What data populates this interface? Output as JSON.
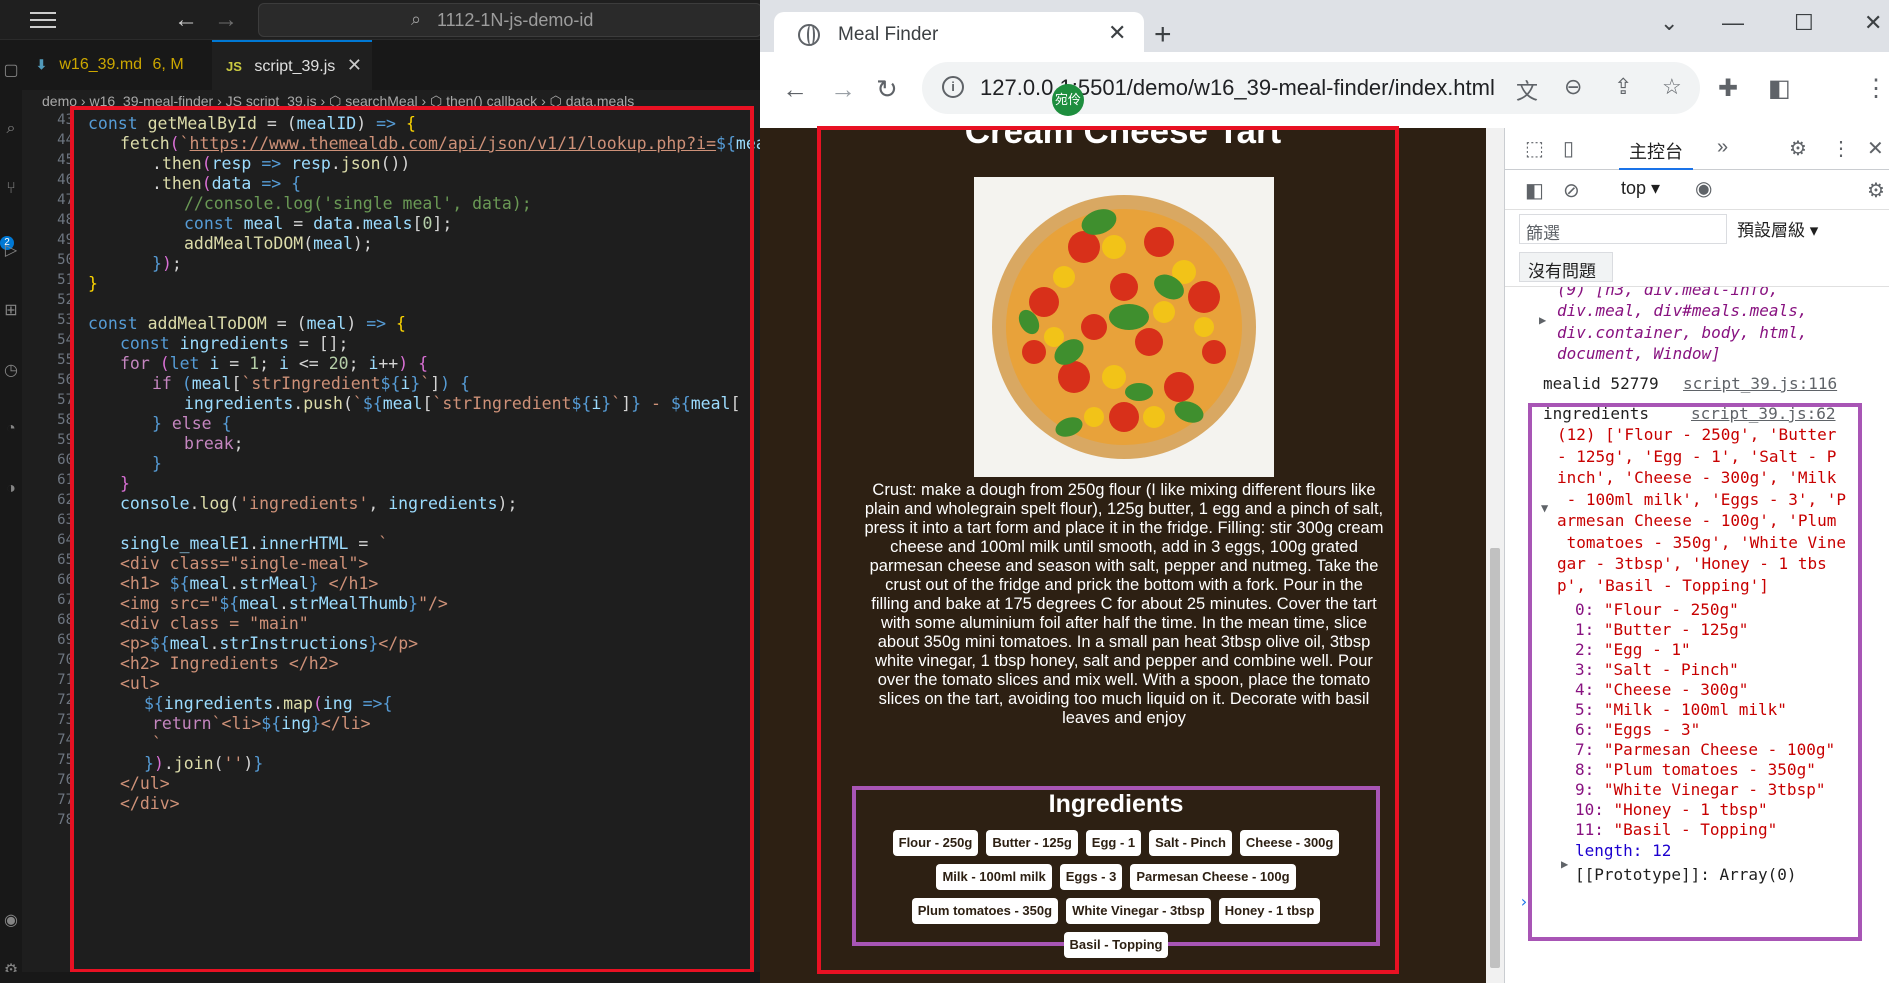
{
  "vscode": {
    "search_text": "1112-1N-js-demo-id",
    "tabs": [
      {
        "label": "w16_39.md",
        "status": "6, M",
        "icon": "md-icon"
      },
      {
        "label": "script_39.js",
        "icon": "js-icon"
      }
    ],
    "js_icon_text": "JS",
    "md_icon_text": "⬇",
    "breadcrumb": "demo › w16_39-meal-finder › JS script_39.js › ⬡ searchMeal › ⬡ then() callback › ⬡ data.meals",
    "line_numbers": [
      "43",
      "44",
      "45",
      "46",
      "47",
      "48",
      "49",
      "50",
      "51",
      "52",
      "53",
      "54",
      "55",
      "56",
      "57",
      "58",
      "59",
      "60",
      "61",
      "62",
      "63",
      "64",
      "65",
      "66",
      "67",
      "68",
      "69",
      "70",
      "71",
      "72",
      "73",
      "74",
      "75",
      "76",
      "77",
      "78"
    ],
    "activity_badge": "2"
  },
  "chrome": {
    "tab_title": "Meal Finder",
    "url": "127.0.0.1:5501/demo/w16_39-meal-finder/index.html",
    "profile_label": "宛伶"
  },
  "page": {
    "meal_title": "Cream Cheese Tart",
    "instructions": "Crust: make a dough from 250g flour (I like mixing different flours like plain and wholegrain spelt flour), 125g butter, 1 egg and a pinch of salt, press it into a tart form and place it in the fridge. Filling: stir 300g cream cheese and 100ml milk until smooth, add in 3 eggs, 100g grated parmesan cheese and season with salt, pepper and nutmeg. Take the crust out of the fridge and prick the bottom with a fork. Pour in the filling and bake at 175 degrees C for about 25 minutes. Cover the tart with some aluminium foil after half the time. In the mean time, slice about 350g mini tomatoes. In a small pan heat 3tbsp olive oil, 3tbsp white vinegar, 1 tbsp honey, salt and pepper and combine well. Pour over the tomato slices and mix well. With a spoon, place the tomato slices on the tart, avoiding too much liquid on it. Decorate with basil leaves and enjoy",
    "ingredients_heading": "Ingredients",
    "ingredients": [
      "Flour - 250g",
      "Butter - 125g",
      "Egg - 1",
      "Salt - Pinch",
      "Cheese - 300g",
      "Milk - 100ml milk",
      "Eggs - 3",
      "Parmesan Cheese - 100g",
      "Plum tomatoes - 350g",
      "White Vinegar - 3tbsp",
      "Honey - 1 tbsp",
      "Basil - Topping"
    ]
  },
  "devtools": {
    "console_tab": "主控台",
    "context": "top",
    "filter_placeholder": "篩選",
    "levels": "預設層級",
    "issues": "沒有問題",
    "log_prev": [
      "(9) [h3, div.meal-info,",
      "div.meal, div#meals.meals,",
      "div.container, body, html,",
      "document, Window]"
    ],
    "mealid_label": "mealid 52779",
    "mealid_src": "script_39.js:116",
    "ing_label": "ingredients",
    "ing_src": "script_39.js:62",
    "ing_summary": [
      "(12) ['Flour - 250g', 'Butter",
      "- 125g', 'Egg - 1', 'Salt - P",
      "inch', 'Cheese - 300g', 'Milk",
      " - 100ml milk', 'Eggs - 3', 'P",
      "armesan Cheese - 100g', 'Plum",
      " tomatoes - 350g', 'White Vine",
      "gar - 3tbsp', 'Honey - 1 tbs",
      "p', 'Basil - Topping']"
    ],
    "length_label": "length: 12",
    "prototype_label": "[[Prototype]]: Array(0)",
    "prompt": "›"
  }
}
